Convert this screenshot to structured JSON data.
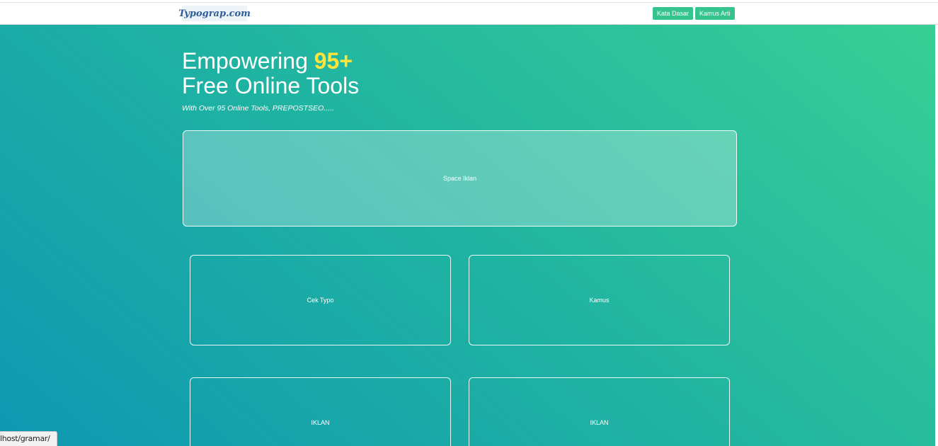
{
  "navbar": {
    "logo_text": "Typograp.com",
    "buttons": [
      {
        "label": "Kata Dasar"
      },
      {
        "label": "Kamus Arti"
      }
    ]
  },
  "hero": {
    "headline_prefix": "Empowering ",
    "headline_accent": "95+",
    "headline_line2": "Free Online Tools",
    "subtext": "With Over 95 Online Tools, PREPOSTSEO.....",
    "ad_banner_label": "Space Iklan",
    "cards": [
      {
        "label": "Cek Typo"
      },
      {
        "label": "Kamus"
      },
      {
        "label": "IKLAN"
      },
      {
        "label": "IKLAN"
      }
    ]
  },
  "status_bar": {
    "url": "lhost/gramar/"
  },
  "colors": {
    "accent_button": "#36c48e",
    "highlight": "#ffe53b",
    "gradient_start": "#0e98b2",
    "gradient_end": "#38cf95"
  }
}
